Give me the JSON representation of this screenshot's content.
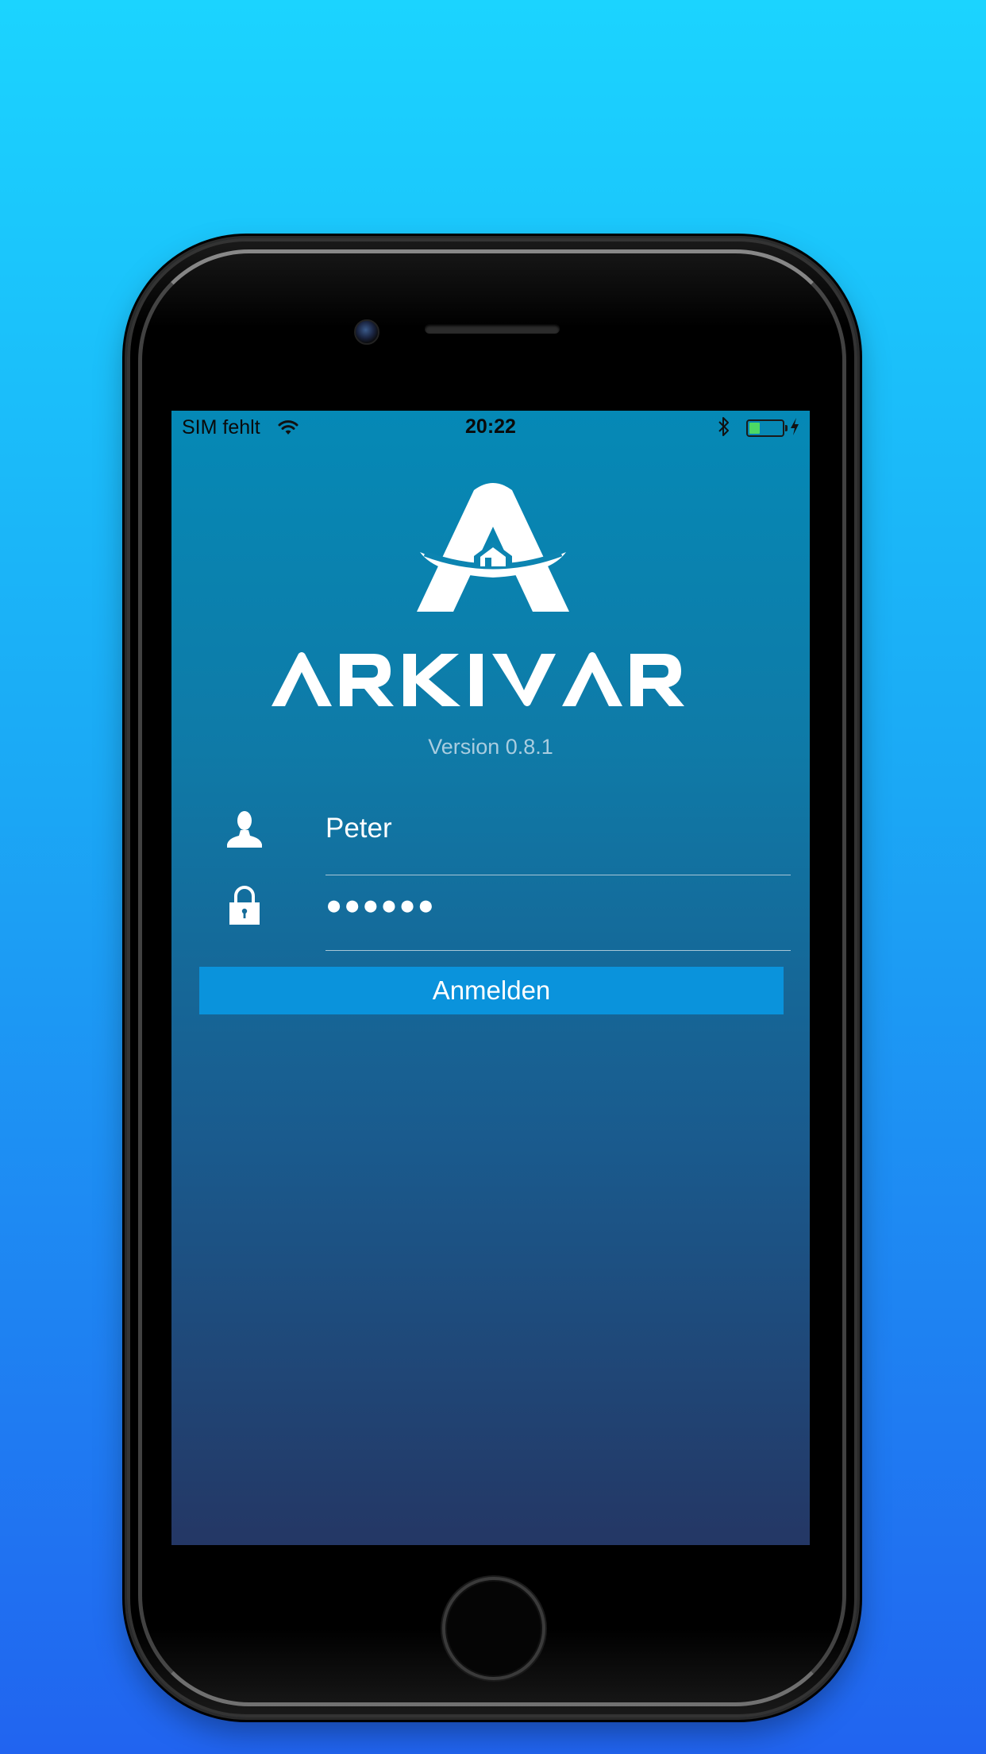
{
  "status_bar": {
    "carrier": "SIM fehlt",
    "time": "20:22",
    "battery_level": 0.35,
    "battery_color": "#4cd964",
    "icons": [
      "wifi-icon",
      "bluetooth-icon",
      "battery-icon",
      "charging-bolt-icon"
    ]
  },
  "app": {
    "brand": "ARKIVAR",
    "version": "Version 0.8.1"
  },
  "login": {
    "username": "Peter",
    "username_icon": "user-icon",
    "password": "●●●●●●",
    "password_icon": "lock-icon",
    "submit_label": "Anmelden",
    "button_color": "#0a93dc"
  }
}
